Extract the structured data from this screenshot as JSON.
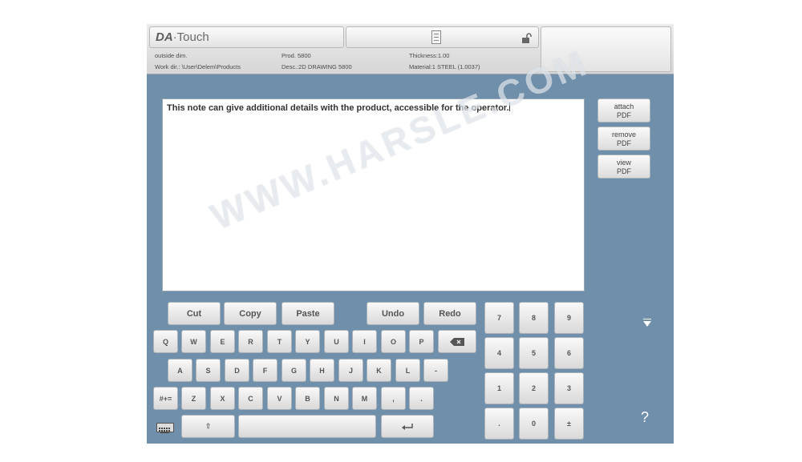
{
  "header": {
    "app_name_bold": "DA",
    "app_name_rest": "·Touch",
    "info": {
      "outside_dim": "outside dim.",
      "prod": "Prod. 5800",
      "thickness": "Thickness:1.00",
      "work_dir": "Work dir.: \\User\\Delem\\Products",
      "desc": "Desc.:2D DRAWING 5800",
      "material": "Material:1 STEEL (1.0037)"
    }
  },
  "note": {
    "text": "This note can give additional details with the product, accessible for the operator."
  },
  "side_buttons": [
    {
      "line1": "attach",
      "line2": "PDF"
    },
    {
      "line1": "remove",
      "line2": "PDF"
    },
    {
      "line1": "view",
      "line2": "PDF"
    }
  ],
  "edit_keys": {
    "cut": "Cut",
    "copy": "Copy",
    "paste": "Paste",
    "undo": "Undo",
    "redo": "Redo"
  },
  "keyboard": {
    "row1": [
      "Q",
      "W",
      "E",
      "R",
      "T",
      "Y",
      "U",
      "I",
      "O",
      "P"
    ],
    "row2": [
      "A",
      "S",
      "D",
      "F",
      "G",
      "H",
      "J",
      "K",
      "L",
      "-"
    ],
    "row3": [
      "Z",
      "X",
      "C",
      "V",
      "B",
      "N",
      "M",
      ",",
      "."
    ],
    "symbols_label": "#+=",
    "shift_label": "⇧"
  },
  "numpad": {
    "rows": [
      [
        "7",
        "8",
        "9"
      ],
      [
        "4",
        "5",
        "6"
      ],
      [
        "1",
        "2",
        "3"
      ],
      [
        ".",
        "0",
        "±"
      ]
    ]
  },
  "help_label": "?",
  "watermark": "WWW.HARSLE.COM"
}
